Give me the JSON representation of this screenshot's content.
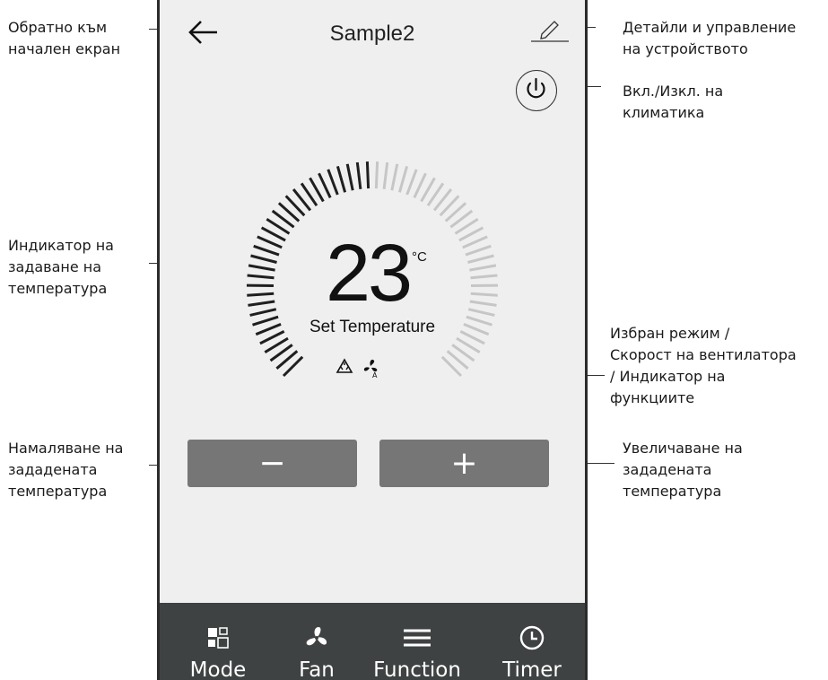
{
  "header": {
    "title": "Sample2"
  },
  "temperature": {
    "value": "23",
    "unit": "°C",
    "label": "Set Temperature",
    "level_fraction": 0.5
  },
  "controls": {
    "minus_label": "−",
    "plus_label": "+"
  },
  "tabs": [
    {
      "label": "Mode",
      "icon": "mode-icon"
    },
    {
      "label": "Fan",
      "icon": "fan-icon"
    },
    {
      "label": "Function",
      "icon": "menu-icon"
    },
    {
      "label": "Timer",
      "icon": "clock-icon"
    }
  ],
  "callouts": {
    "back": "Обратно към\nначален екран",
    "details": "Детайли и управление\nна устройството",
    "power": "Вкл./Изкл. на\nклиматика",
    "indicator": "Индикатор на\nзадаване на\nтемпература",
    "mode": "Избран режим /\nСкорост на вентилатора\n/ Индикатор на\nфункциите",
    "decrease": "Намаляване на\nзададената\nтемпература",
    "increase": "Увеличаване на\nзададената\nтемпература"
  },
  "colors": {
    "screen_bg": "#efefef",
    "button_bg": "#767676",
    "bottom_bar_bg": "#3f4242",
    "tick_active": "#1f1f1f",
    "tick_inactive": "#c6c6c6"
  }
}
